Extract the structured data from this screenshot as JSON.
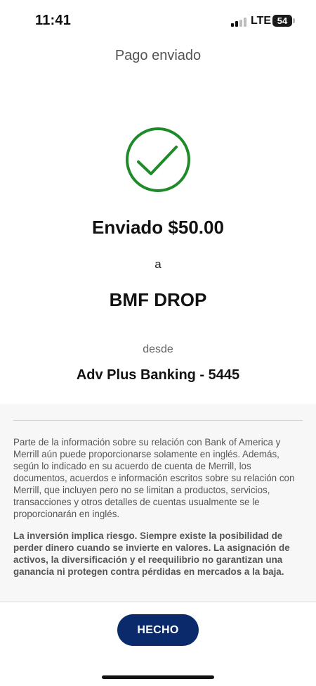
{
  "status_bar": {
    "time": "11:41",
    "network": "LTE",
    "battery": "54",
    "signal_icon": "cellular-signal-icon"
  },
  "header": {
    "title": "Pago enviado"
  },
  "confirmation": {
    "icon": "checkmark-circle-icon",
    "icon_color": "#1e8a2a",
    "amount_text": "Enviado $50.00",
    "to_label": "a",
    "recipient": "BMF DROP",
    "from_label": "desde",
    "account": "Adv Plus Banking - 5445"
  },
  "disclosures": {
    "language_notice": "Parte de la información sobre su relación con Bank of America y Merrill aún puede proporcionarse solamente en inglés. Además, según lo indicado en su acuerdo de cuenta de Merrill, los documentos, acuerdos e información escritos sobre su relación con Merrill, que incluyen pero no se limitan a productos, servicios, transacciones y otros detalles de cuentas usualmente se le proporcionarán en inglés.",
    "risk_notice": "La inversión implica riesgo. Siempre existe la posibilidad de perder dinero cuando se invierte en valores. La asignación de activos, la diversificación y el reequilibrio no garantizan una ganancia ni protegen contra pérdidas en mercados a la baja."
  },
  "footer": {
    "done_label": "HECHO",
    "button_color": "#0a2a6b"
  }
}
